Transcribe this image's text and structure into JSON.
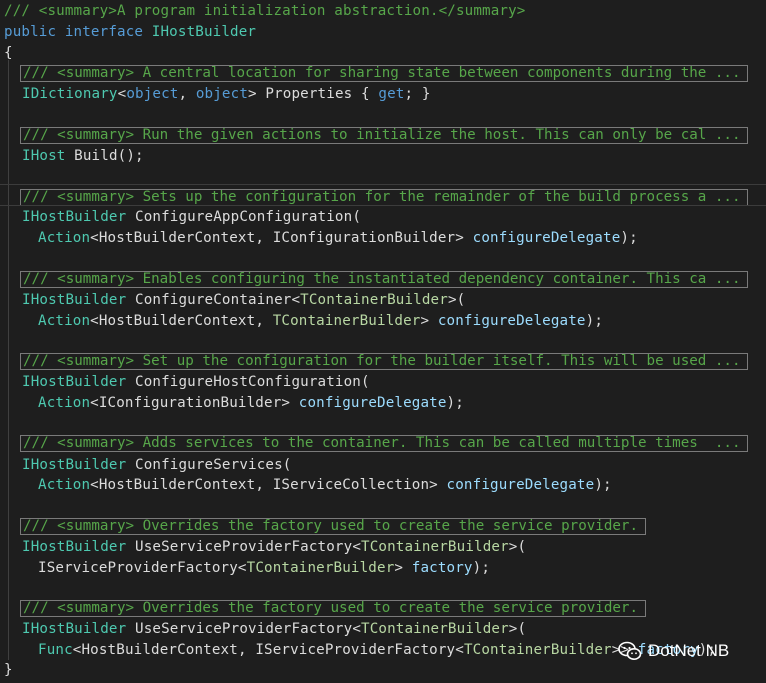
{
  "code": {
    "line1_comment": "/// <summary>A program initialization abstraction.</summary>",
    "line2_public": "public",
    "line2_interface": "interface",
    "line2_name": "IHostBuilder",
    "brace_open": "{",
    "brace_close": "}",
    "collapsed": [
      "/// <summary> A central location for sharing state between components during the ...",
      "/// <summary> Run the given actions to initialize the host. This can only be cal ...",
      "/// <summary> Sets up the configuration for the remainder of the build process a ...",
      "/// <summary> Enables configuring the instantiated dependency container. This ca ...",
      "/// <summary> Set up the configuration for the builder itself. This will be used ...",
      "/// <summary> Adds services to the container. This can be called multiple times  ...",
      "/// <summary> Overrides the factory used to create the service provider.",
      "/// <summary> Overrides the factory used to create the service provider."
    ],
    "t_IDictionary": "IDictionary",
    "t_object": "object",
    "t_IHost": "IHost",
    "t_IHostBuilder": "IHostBuilder",
    "t_Action": "Action",
    "t_Func": "Func",
    "t_HostBuilderContext": "HostBuilderContext",
    "t_IConfigurationBuilder": "IConfigurationBuilder",
    "t_IServiceCollection": "IServiceCollection",
    "t_IServiceProviderFactory": "IServiceProviderFactory",
    "tp_TContainerBuilder": "TContainerBuilder",
    "kw_get": "get",
    "m_Properties": "Properties",
    "m_Build": "Build",
    "m_ConfigureAppConfiguration": "ConfigureAppConfiguration",
    "m_ConfigureContainer": "ConfigureContainer",
    "m_ConfigureHostConfiguration": "ConfigureHostConfiguration",
    "m_ConfigureServices": "ConfigureServices",
    "m_UseServiceProviderFactory": "UseServiceProviderFactory",
    "p_configureDelegate": "configureDelegate",
    "p_factory": "factory"
  },
  "watermark": {
    "text": "DotNet NB",
    "icon": "wechat-icon"
  }
}
